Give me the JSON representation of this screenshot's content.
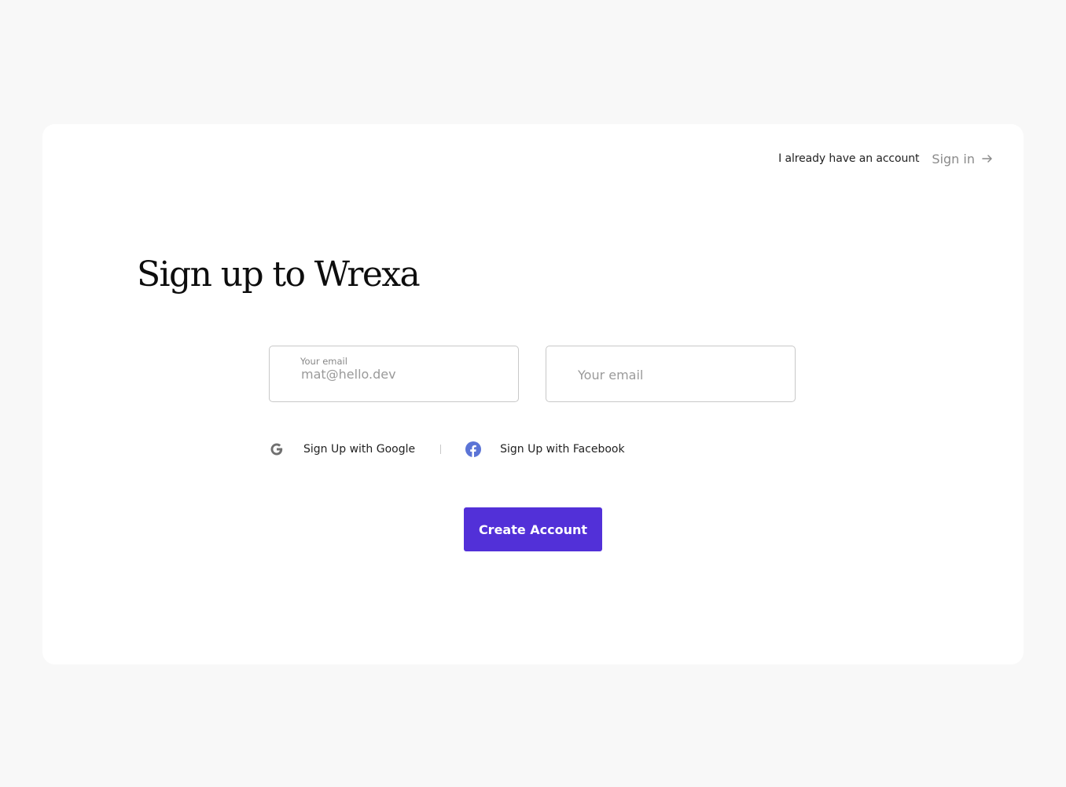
{
  "header": {
    "already_text": "I already have an account",
    "signin_label": "Sign in",
    "signin_icon": "arrow-right-icon"
  },
  "title": "Sign up to Wrexa",
  "form": {
    "email_field": {
      "label": "Your email",
      "value": "mat@hello.dev"
    },
    "email_field_2": {
      "placeholder": "Your email",
      "value": ""
    }
  },
  "social": {
    "google": {
      "label": "Sign Up with Google",
      "icon": "google-icon",
      "color": "#707070"
    },
    "facebook": {
      "label": "Sign Up with Facebook",
      "icon": "facebook-icon",
      "color": "#5b74d6"
    }
  },
  "cta": {
    "label": "Create Account",
    "color": "#5230d8"
  }
}
